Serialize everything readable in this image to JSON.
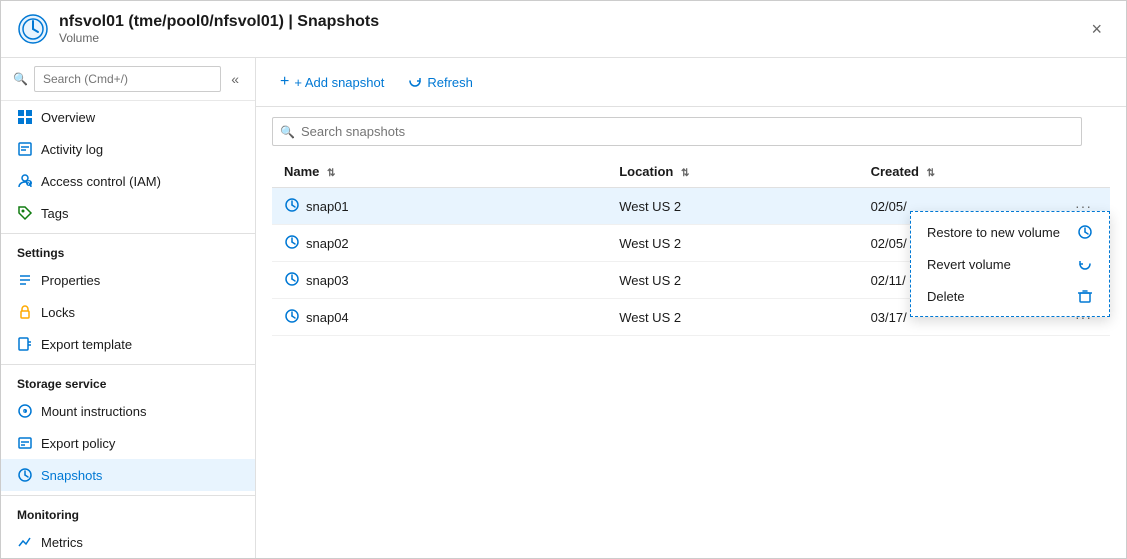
{
  "window": {
    "title": "nfsvol01 (tme/pool0/nfsvol01) | Snapshots",
    "subtitle": "Volume",
    "close_label": "×"
  },
  "sidebar": {
    "search_placeholder": "Search (Cmd+/)",
    "collapse_icon": "«",
    "nav_items": [
      {
        "id": "overview",
        "label": "Overview",
        "icon": "overview"
      },
      {
        "id": "activity-log",
        "label": "Activity log",
        "icon": "activity"
      },
      {
        "id": "iam",
        "label": "Access control (IAM)",
        "icon": "iam"
      },
      {
        "id": "tags",
        "label": "Tags",
        "icon": "tags"
      }
    ],
    "sections": [
      {
        "label": "Settings",
        "items": [
          {
            "id": "properties",
            "label": "Properties",
            "icon": "properties"
          },
          {
            "id": "locks",
            "label": "Locks",
            "icon": "locks"
          },
          {
            "id": "export-template",
            "label": "Export template",
            "icon": "export"
          }
        ]
      },
      {
        "label": "Storage service",
        "items": [
          {
            "id": "mount-instructions",
            "label": "Mount instructions",
            "icon": "mount"
          },
          {
            "id": "export-policy",
            "label": "Export policy",
            "icon": "policy"
          },
          {
            "id": "snapshots",
            "label": "Snapshots",
            "icon": "snapshots",
            "active": true
          }
        ]
      },
      {
        "label": "Monitoring",
        "items": [
          {
            "id": "metrics",
            "label": "Metrics",
            "icon": "metrics"
          }
        ]
      }
    ]
  },
  "toolbar": {
    "add_snapshot_label": "+ Add snapshot",
    "refresh_label": "Refresh"
  },
  "search": {
    "placeholder": "Search snapshots"
  },
  "table": {
    "columns": [
      {
        "id": "name",
        "label": "Name"
      },
      {
        "id": "location",
        "label": "Location"
      },
      {
        "id": "created",
        "label": "Created"
      }
    ],
    "rows": [
      {
        "id": "snap01",
        "name": "snap01",
        "location": "West US 2",
        "created": "02/05/",
        "selected": true
      },
      {
        "id": "snap02",
        "name": "snap02",
        "location": "West US 2",
        "created": "02/05/",
        "selected": false
      },
      {
        "id": "snap03",
        "name": "snap03",
        "location": "West US 2",
        "created": "02/11/",
        "selected": false
      },
      {
        "id": "snap04",
        "name": "snap04",
        "location": "West US 2",
        "created": "03/17/",
        "selected": false
      }
    ]
  },
  "context_menu": {
    "items": [
      {
        "id": "restore",
        "label": "Restore to new volume",
        "icon": "restore"
      },
      {
        "id": "revert",
        "label": "Revert volume",
        "icon": "revert"
      },
      {
        "id": "delete",
        "label": "Delete",
        "icon": "delete"
      }
    ]
  }
}
